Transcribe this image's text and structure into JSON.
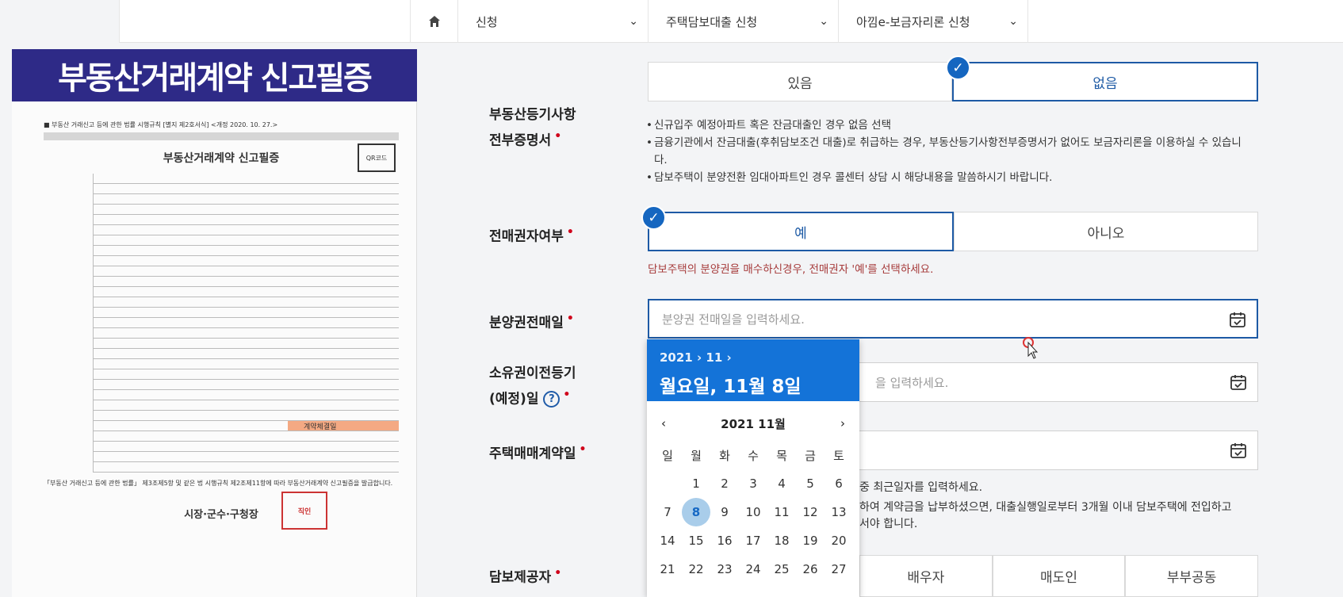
{
  "nav": {
    "home_icon": "home-icon",
    "items": [
      {
        "label": "신청"
      },
      {
        "label": "주택담보대출 신청"
      },
      {
        "label": "아낌e-보금자리론 신청"
      }
    ]
  },
  "overlay": {
    "banner": "부동산거래계약 신고필증",
    "doc_ref": "■ 부동산 거래신고 등에 관한 법률 시행규칙 [별지 제2호서식] <개정 2020. 10. 27.>",
    "doc_title": "부동산거래계약 신고필증",
    "doc_qr": "QR코드",
    "doc_highlight": "계약체결일",
    "doc_notice": "「부동산 거래신고 등에 관한 법률」 제3조제5항 및 같은 법 시행규칙 제2조제11항에 따라 부동산거래계약 신고필증을 발급합니다.",
    "doc_agency": "시장·군수·구청장",
    "doc_seal": "직인"
  },
  "form": {
    "registry": {
      "label_line1": "부동산등기사항",
      "label_line2": "전부증명서",
      "option_yes": "있음",
      "option_no": "없음",
      "selected": "없음",
      "notes": [
        "신규입주 예정아파트 혹은 잔금대출인 경우 없음 선택",
        "금융기관에서 잔금대출(후취담보조건 대출)로 취급하는 경우, 부동산등기사항전부증명서가 없어도 보금자리론을 이용하실 수 있습니다.",
        "담보주택이 분양전환 임대아파트인 경우 콜센터 상담 시 해당내용을 말씀하시기 바랍니다."
      ]
    },
    "resale": {
      "label": "전매권자여부",
      "option_yes": "예",
      "option_no": "아니오",
      "selected": "예",
      "warning": "담보주택의 분양권을 매수하신경우, 전매권자 '예'를 선택하세요."
    },
    "resale_date": {
      "label": "분양권전매일",
      "placeholder": "분양권 전매일을 입력하세요."
    },
    "transfer_date": {
      "label_line1": "소유권이전등기",
      "label_line2": "(예정)일",
      "help": "?",
      "placeholder_visible": "을 입력하세요."
    },
    "contract_date": {
      "label": "주택매매계약일",
      "note1_visible": "중 최근일자를 입력하세요.",
      "note2_visible": "하여 계약금을 납부하셨으면, 대출실행일로부터 3개월 이내 담보주택에 전입하고",
      "note3_visible": "서야 합니다."
    },
    "co_owner": {
      "label": "담보제공자",
      "options_visible": [
        "배우자",
        "매도인",
        "부부공동"
      ]
    }
  },
  "calendar": {
    "year": "2021",
    "month_short": "11",
    "selected_display": "월요일, 11월 8일",
    "month_title": "2021 11월",
    "weekdays": [
      "일",
      "월",
      "화",
      "수",
      "목",
      "금",
      "토"
    ],
    "days": [
      "",
      "1",
      "2",
      "3",
      "4",
      "5",
      "6",
      "7",
      "8",
      "9",
      "10",
      "11",
      "12",
      "13",
      "14",
      "15",
      "16",
      "17",
      "18",
      "19",
      "20",
      "21",
      "22",
      "23",
      "24",
      "25",
      "26",
      "27"
    ],
    "selected_day": "8"
  },
  "colors": {
    "accent": "#1d5aa5",
    "calendar_header": "#1473d8",
    "check_badge": "#1566c0",
    "banner": "#2e2a87",
    "warning": "#a63a3a"
  }
}
